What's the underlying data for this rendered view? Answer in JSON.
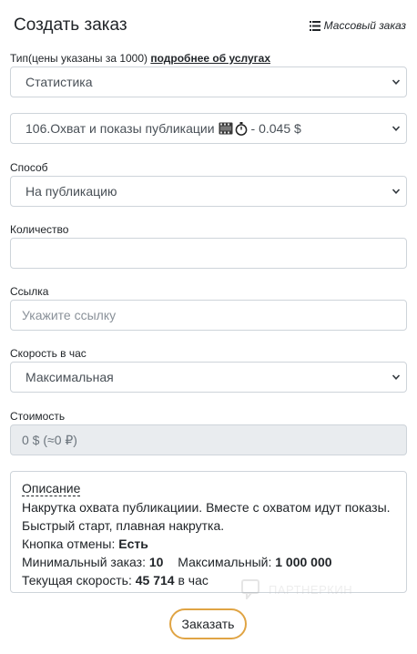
{
  "header": {
    "title": "Создать заказ",
    "mass_order_label": "Массовый заказ"
  },
  "type_field": {
    "label": "Тип(цены указаны за 1000)",
    "link_text": "подробнее об услугах",
    "value": "Статистика"
  },
  "service_field": {
    "value_prefix": "106.Охват и показы публикации",
    "value_suffix": "- 0.045 $",
    "icons": [
      "film-icon",
      "stopwatch-icon"
    ]
  },
  "method_field": {
    "label": "Способ",
    "value": "На публикацию"
  },
  "quantity_field": {
    "label": "Количество",
    "value": ""
  },
  "link_field": {
    "label": "Ссылка",
    "placeholder": "Укажите ссылку"
  },
  "speed_field": {
    "label": "Скорость в час",
    "value": "Максимальная"
  },
  "cost_field": {
    "label": "Стоимость",
    "value": "0 $ (≈0 ₽)"
  },
  "description": {
    "title": "Описание",
    "line1": "Накрутка охвата публикациии. Вместе с охватом идут показы.",
    "line2": "Быстрый старт, плавная накрутка.",
    "cancel_label": "Кнопка отмены:",
    "cancel_value": "Есть",
    "min_label": "Минимальный заказ:",
    "min_value": "10",
    "max_label": "Максимальный:",
    "max_value": "1 000 000",
    "speed_label": "Текущая скорость:",
    "speed_value": "45 714",
    "speed_unit": "в час"
  },
  "watermark_text": "ПАРТНЕРКИН",
  "order_button_label": "Заказать",
  "colors": {
    "accent_border": "#e0a444",
    "input_border": "#ced4da",
    "disabled_bg": "#e9ecef"
  }
}
